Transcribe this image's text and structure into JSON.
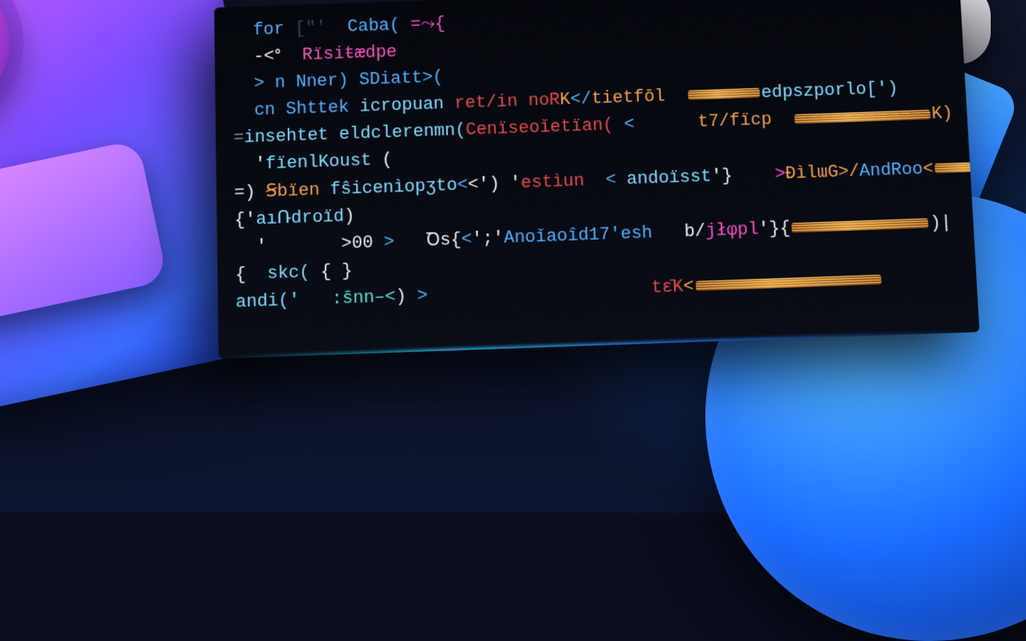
{
  "code": {
    "l1a": "for",
    "l1b": "[\"ꞌ",
    "l1c": "Caba(",
    "l1d": "=⤳{",
    "l2a": "-<ᐤ",
    "l2b": "Rïsiŧædpe",
    "l3a": ">",
    "l3b": "n",
    "l3c": "Nner)",
    "l3d": "SDiatt>(",
    "l4a": "cn",
    "l4b": "Shttek",
    "l4c": "icropuan",
    "l4d": "ret/in noR",
    "l4e": "K",
    "l4f": "</",
    "l4g": "tietfōl",
    "l4h": "edpszporlo[')",
    "l5a": "=",
    "l5b": "insehtet",
    "l5c": "eldclerenmn(",
    "l5d": "Cenïseoĭetïan(",
    "l5e": "<",
    "l5f": "t7/fïcp",
    "l6a": "'",
    "l6b": "fïenlKoust",
    "l6c": "(",
    "l7a": "=)",
    "l7b": "Ꞩbïen",
    "l7c": "fŝicenìopʒto",
    "l7d": "<",
    "l7e": "<') '",
    "l7f": "estìun",
    "l7g": "<",
    "l7h": "andoïsst",
    "l7i": "'}",
    "l7j": ">",
    "l7k": "ÐìlɯG>/",
    "l7l": "AndRoo",
    "l7m": "<",
    "l8a": "{'",
    "l8b": "aıՌdroïd",
    "l8c": ")",
    "l9a": "'",
    "l9b": ">00",
    "l9c": ">",
    "l9d": "Ꝺs{",
    "l9e": "<",
    "l9f": "';'",
    "l9g": "Anoǐaoîd17'esh",
    "l9h": "b/",
    "l9i": "jłφpl",
    "l9j": "'}{",
    "l9k": ")|",
    "l10a": "{",
    "l10b": "skc(",
    "l10c": "{ }",
    "l11a": "andi('",
    "l11b": ":s̄nn‒<",
    "l11c": ")",
    "l11d": ">",
    "l11e": "tɛ̄K",
    "l11f": "<"
  }
}
